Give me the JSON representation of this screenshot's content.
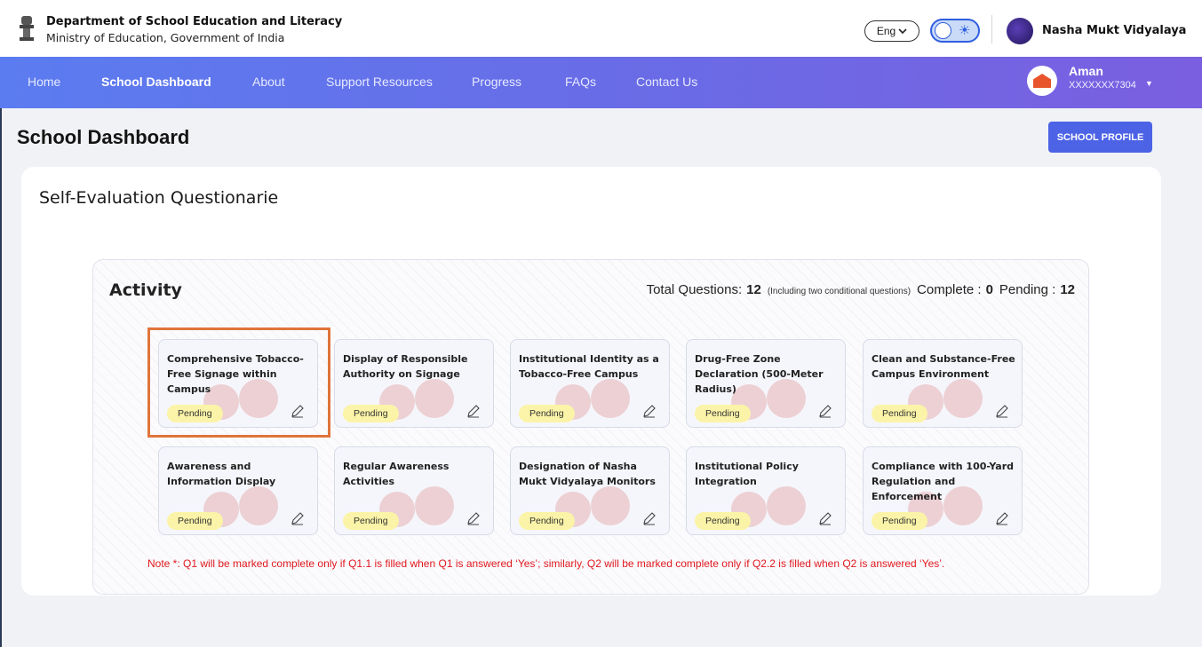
{
  "header": {
    "dept_title": "Department of School Education and Literacy",
    "dept_subtitle": "Ministry of Education, Government of India",
    "language": "Eng",
    "brand": "Nasha Mukt Vidyalaya"
  },
  "nav": {
    "items": [
      {
        "label": "Home",
        "active": false
      },
      {
        "label": "School Dashboard",
        "active": true
      },
      {
        "label": "About",
        "active": false
      },
      {
        "label": "Support Resources",
        "active": false
      },
      {
        "label": "Progress",
        "active": false
      },
      {
        "label": "FAQs",
        "active": false
      },
      {
        "label": "Contact Us",
        "active": false
      }
    ],
    "user_name": "Aman",
    "user_id": "XXXXXXX7304"
  },
  "page": {
    "title": "School Dashboard",
    "profile_button": "SCHOOL PROFILE",
    "panel_title": "Self-Evaluation Questionarie"
  },
  "activity": {
    "title": "Activity",
    "total_label": "Total Questions:",
    "total_value": "12",
    "total_note": "(Including two conditional questions)",
    "complete_label": "Complete :",
    "complete_value": "0",
    "pending_label": "Pending :",
    "pending_value": "12",
    "cards": [
      {
        "title": "Comprehensive Tobacco-Free Signage within Campus",
        "status": "Pending",
        "selected": true
      },
      {
        "title": "Display of Responsible Authority on Signage",
        "status": "Pending"
      },
      {
        "title": "Institutional Identity as a Tobacco-Free Campus",
        "status": "Pending"
      },
      {
        "title": "Drug-Free Zone Declaration (500-Meter Radius)",
        "status": "Pending"
      },
      {
        "title": "Clean and Substance-Free Campus Environment",
        "status": "Pending"
      },
      {
        "title": "Awareness and Information Display",
        "status": "Pending"
      },
      {
        "title": "Regular Awareness Activities",
        "status": "Pending"
      },
      {
        "title": "Designation of Nasha Mukt Vidyalaya Monitors",
        "status": "Pending"
      },
      {
        "title": "Institutional Policy Integration",
        "status": "Pending"
      },
      {
        "title": "Compliance with 100-Yard Regulation and Enforcement",
        "status": "Pending"
      }
    ],
    "note": "Note *: Q1 will be marked complete only if Q1.1 is filled when Q1 is answered ‘Yes’; similarly, Q2 will be marked complete only if Q2.2 is filled when Q2 is answered ‘Yes’."
  },
  "colors": {
    "nav_start": "#5b7cf0",
    "nav_end": "#7a5fe0",
    "primary_button": "#4c63e6",
    "pending_badge": "#fbf4a8",
    "highlight": "#e0743b",
    "note": "#e0181f"
  }
}
